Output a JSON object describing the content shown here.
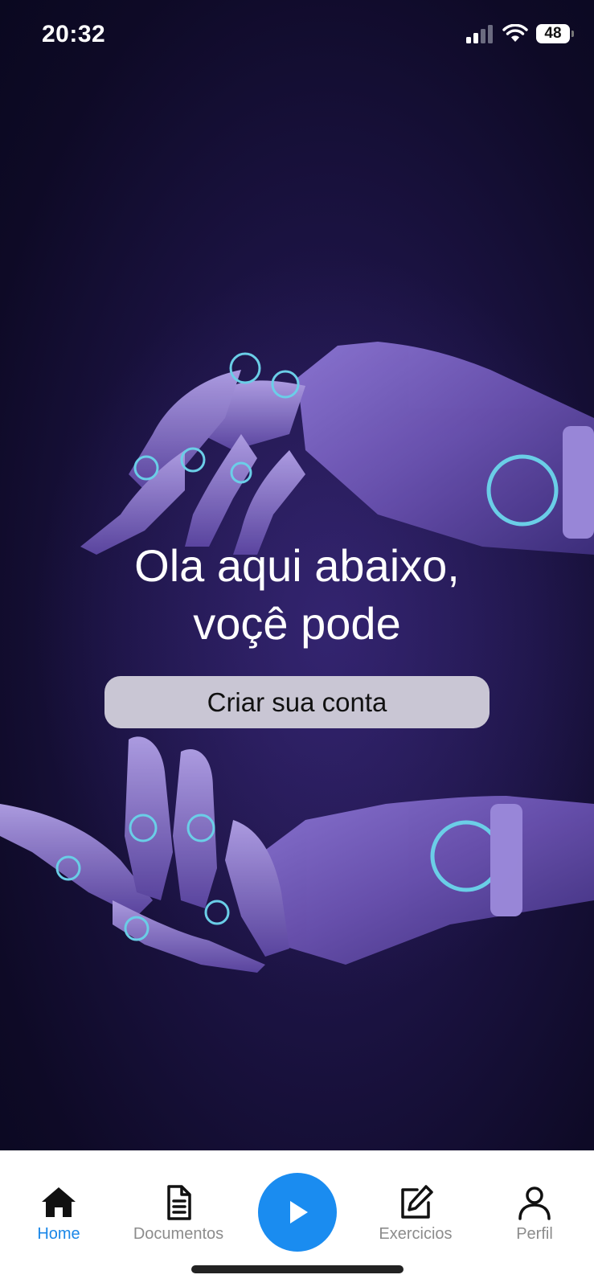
{
  "status_bar": {
    "time": "20:32",
    "battery": "48"
  },
  "hero": {
    "headline_line1": "Ola aqui abaixo,",
    "headline_line2": "voçê pode",
    "cta_label": "Criar sua conta"
  },
  "tab_bar": {
    "items": [
      {
        "label": "Home",
        "icon": "home-icon",
        "active": true
      },
      {
        "label": "Documentos",
        "icon": "document-icon",
        "active": false
      },
      {
        "label": "",
        "icon": "play-icon",
        "active": false
      },
      {
        "label": "Exercicios",
        "icon": "edit-icon",
        "active": false
      },
      {
        "label": "Perfil",
        "icon": "user-icon",
        "active": false
      }
    ]
  },
  "colors": {
    "accent": "#1a87e8",
    "play_button": "#1a8cf0",
    "background_dark": "#0e0a26",
    "robot_purple": "#6e55b8",
    "cta_bg": "#c9c6d4"
  }
}
